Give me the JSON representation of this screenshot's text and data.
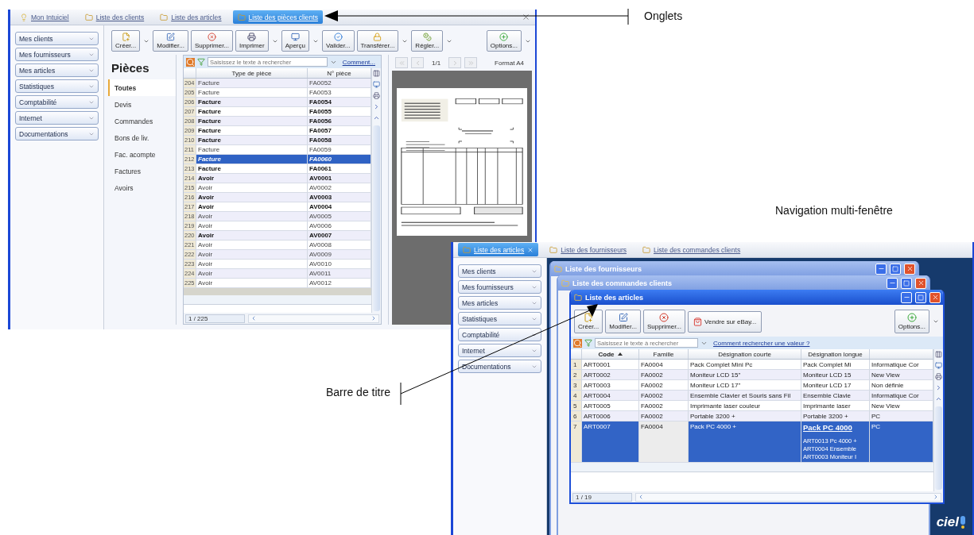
{
  "annotations": [
    {
      "kind": "tabs",
      "label": "Onglets"
    },
    {
      "kind": "multiwindow",
      "label": "Navigation multi-fenêtre"
    },
    {
      "kind": "titlebar",
      "label": "Barre de titre"
    }
  ],
  "screen_1": {
    "tabs": [
      {
        "label": "Mon Intuiciel",
        "selected": false
      },
      {
        "label": "Liste des clients",
        "selected": false
      },
      {
        "label": "Liste des articles",
        "selected": false
      },
      {
        "label": "Liste des pièces clients",
        "selected": true
      }
    ],
    "sidebar": {
      "items": [
        "Mes clients",
        "Mes fournisseurs",
        "Mes articles",
        "Statistiques",
        "Comptabilité",
        "Internet",
        "Documentations"
      ]
    },
    "toolbar": {
      "buttons": [
        {
          "label": "Créer...",
          "dropdown": true
        },
        {
          "label": "Modifier...",
          "dropdown": false
        },
        {
          "label": "Supprimer...",
          "dropdown": false
        },
        {
          "label": "Imprimer",
          "dropdown": true
        },
        {
          "label": "Aperçu",
          "dropdown": true
        },
        {
          "label": "Valider...",
          "dropdown": false
        },
        {
          "label": "Transférer...",
          "dropdown": true
        },
        {
          "label": "Régler...",
          "dropdown": true
        }
      ],
      "options": {
        "label": "Options...",
        "dropdown": true
      }
    },
    "categories": {
      "title": "Pièces",
      "items": [
        {
          "label": "Toutes",
          "selected": true
        },
        {
          "label": "Devis",
          "selected": false
        },
        {
          "label": "Commandes",
          "selected": false
        },
        {
          "label": "Bons de liv.",
          "selected": false
        },
        {
          "label": "Fac. acompte",
          "selected": false
        },
        {
          "label": "Factures",
          "selected": false
        },
        {
          "label": "Avoirs",
          "selected": false
        }
      ]
    },
    "search": {
      "placeholder": "Saisissez le texte à rechercher",
      "help_link": "Comment..."
    },
    "table": {
      "columns": [
        "Type de pièce",
        "N° pièce"
      ],
      "rows": [
        {
          "num": "204",
          "type": "Facture",
          "number": "FA0052",
          "unread": false,
          "selected": false
        },
        {
          "num": "205",
          "type": "Facture",
          "number": "FA0053",
          "unread": false,
          "selected": false
        },
        {
          "num": "206",
          "type": "Facture",
          "number": "FA0054",
          "unread": true,
          "selected": false
        },
        {
          "num": "207",
          "type": "Facture",
          "number": "FA0055",
          "unread": true,
          "selected": false
        },
        {
          "num": "208",
          "type": "Facture",
          "number": "FA0056",
          "unread": true,
          "selected": false
        },
        {
          "num": "209",
          "type": "Facture",
          "number": "FA0057",
          "unread": true,
          "selected": false
        },
        {
          "num": "210",
          "type": "Facture",
          "number": "FA0058",
          "unread": true,
          "selected": false
        },
        {
          "num": "211",
          "type": "Facture",
          "number": "FA0059",
          "unread": false,
          "selected": false
        },
        {
          "num": "212",
          "type": "Facture",
          "number": "FA0060",
          "unread": true,
          "selected": true
        },
        {
          "num": "213",
          "type": "Facture",
          "number": "FA0061",
          "unread": true,
          "selected": false
        },
        {
          "num": "214",
          "type": "Avoir",
          "number": "AV0001",
          "unread": true,
          "selected": false
        },
        {
          "num": "215",
          "type": "Avoir",
          "number": "AV0002",
          "unread": false,
          "selected": false
        },
        {
          "num": "216",
          "type": "Avoir",
          "number": "AV0003",
          "unread": true,
          "selected": false
        },
        {
          "num": "217",
          "type": "Avoir",
          "number": "AV0004",
          "unread": true,
          "selected": false
        },
        {
          "num": "218",
          "type": "Avoir",
          "number": "AV0005",
          "unread": false,
          "selected": false
        },
        {
          "num": "219",
          "type": "Avoir",
          "number": "AV0006",
          "unread": false,
          "selected": false
        },
        {
          "num": "220",
          "type": "Avoir",
          "number": "AV0007",
          "unread": true,
          "selected": false
        },
        {
          "num": "221",
          "type": "Avoir",
          "number": "AV0008",
          "unread": false,
          "selected": false
        },
        {
          "num": "222",
          "type": "Avoir",
          "number": "AV0009",
          "unread": false,
          "selected": false
        },
        {
          "num": "223",
          "type": "Avoir",
          "number": "AV0010",
          "unread": false,
          "selected": false
        },
        {
          "num": "224",
          "type": "Avoir",
          "number": "AV0011",
          "unread": false,
          "selected": false
        },
        {
          "num": "225",
          "type": "Avoir",
          "number": "AV0012",
          "unread": false,
          "selected": false
        }
      ],
      "footer": "1 / 225"
    },
    "preview": {
      "page": "1/1",
      "format": "Format A4"
    }
  },
  "screen_2": {
    "tabs": [
      {
        "label": "Liste des articles",
        "selected": true
      },
      {
        "label": "Liste des fournisseurs",
        "selected": false
      },
      {
        "label": "Liste des commandes clients",
        "selected": false
      }
    ],
    "sidebar": {
      "items": [
        "Mes clients",
        "Mes fournisseurs",
        "Mes articles",
        "Statistiques",
        "Comptabilité",
        "Internet",
        "Documentations"
      ]
    },
    "windows": [
      {
        "title": "Liste des fournisseurs",
        "active": false
      },
      {
        "title": "Liste des commandes clients",
        "active": false
      },
      {
        "title": "Liste des articles",
        "active": true
      }
    ],
    "articles": {
      "toolbar": {
        "buttons": [
          {
            "label": "Créer...",
            "kind": "plain"
          },
          {
            "label": "Modifier...",
            "kind": "plain"
          },
          {
            "label": "Supprimer...",
            "kind": "plain"
          },
          {
            "label": "Vendre sur eBay...",
            "kind": "ebay"
          }
        ],
        "options": "Options..."
      },
      "search": {
        "placeholder": "Saisissez le texte à rechercher",
        "help_link": "Comment rechercher une valeur ?"
      },
      "table": {
        "columns": [
          {
            "label": "Code",
            "sorted": true
          },
          {
            "label": "Famille",
            "sorted": false
          },
          {
            "label": "Désignation courte",
            "sorted": false
          },
          {
            "label": "Désignation longue",
            "sorted": false
          }
        ],
        "rows": [
          {
            "num": "1",
            "code": "ART0001",
            "family": "FA0004",
            "short": "Pack Complet Mini Pc",
            "long": "Pack Complet Mi",
            "column_5": "Informatique Cor",
            "selected": false
          },
          {
            "num": "2",
            "code": "ART0002",
            "family": "FA0002",
            "short": "Moniteur LCD 15\"",
            "long": "Moniteur LCD 15",
            "column_5": "New View",
            "selected": false
          },
          {
            "num": "3",
            "code": "ART0003",
            "family": "FA0002",
            "short": "Moniteur LCD 17\"",
            "long": "Moniteur LCD 17",
            "column_5": "Non définie",
            "selected": false
          },
          {
            "num": "4",
            "code": "ART0004",
            "family": "FA0002",
            "short": "Ensemble Clavier et Souris sans Fil",
            "long": "Ensemble Clavie",
            "column_5": "Informatique Cor",
            "selected": false
          },
          {
            "num": "5",
            "code": "ART0005",
            "family": "FA0002",
            "short": "Imprimante laser couleur",
            "long": "Imprimante laser",
            "column_5": "New View",
            "selected": false
          },
          {
            "num": "6",
            "code": "ART0006",
            "family": "FA0002",
            "short": "Portable 3200 +",
            "long": "Portable 3200 +",
            "column_5": "PC",
            "selected": false
          },
          {
            "num": "7",
            "code": "ART0007",
            "family": "FA0004",
            "short": "Pack PC 4000 +",
            "long": "Pack PC 4000",
            "column_5": "PC",
            "selected": true,
            "details": [
              "ART0013 Pc 4000 +",
              "ART0004 Ensemble",
              "ART0003 Moniteur I"
            ]
          }
        ],
        "footer": "1 / 19"
      }
    },
    "logo": "ciel"
  }
}
